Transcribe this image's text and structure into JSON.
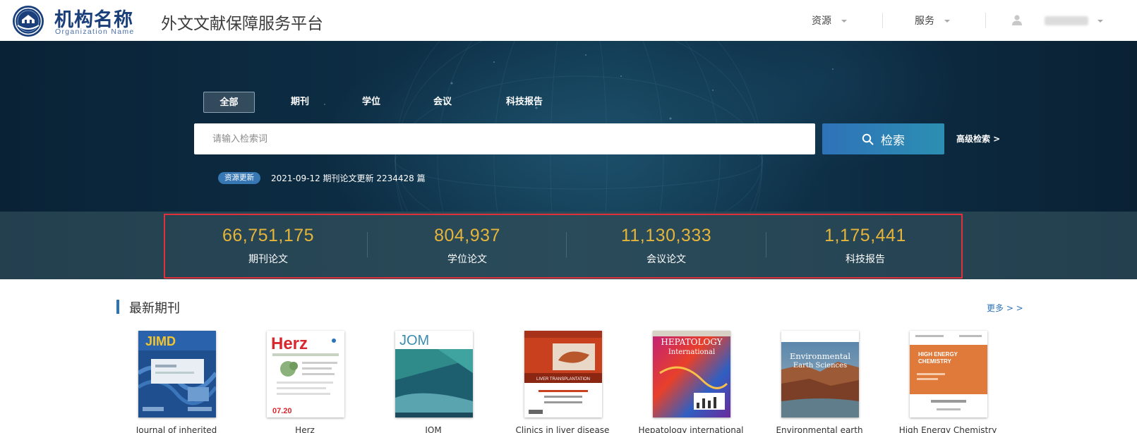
{
  "header": {
    "org_name": "机构名称",
    "org_name_en": "Organization Name",
    "platform_title": "外文文献保障服务平台",
    "nav": [
      {
        "label": "资源"
      },
      {
        "label": "服务"
      }
    ]
  },
  "search": {
    "tabs": [
      {
        "label": "全部",
        "active": true
      },
      {
        "label": "期刊",
        "active": false
      },
      {
        "label": "学位",
        "active": false
      },
      {
        "label": "会议",
        "active": false
      },
      {
        "label": "科技报告",
        "active": false
      }
    ],
    "placeholder": "请输入检索词",
    "button_label": "检索",
    "advanced_label": "高级检索 >",
    "update_badge": "资源更新",
    "update_text": "2021-09-12 期刊论文更新 2234428 篇"
  },
  "stats": [
    {
      "value": "66,751,175",
      "label": "期刊论文"
    },
    {
      "value": "804,937",
      "label": "学位论文"
    },
    {
      "value": "11,130,333",
      "label": "会议论文"
    },
    {
      "value": "1,175,441",
      "label": "科技报告"
    }
  ],
  "latest_journals": {
    "title": "最新期刊",
    "more_label": "更多 > >",
    "items": [
      {
        "title": "Journal of inherited",
        "cover_text": "JIMD"
      },
      {
        "title": "Herz",
        "cover_text": "Herz",
        "cover_subtext": "07.20"
      },
      {
        "title": "JOM",
        "cover_text": "JOM"
      },
      {
        "title": "Clinics in liver disease",
        "cover_text": "LIVER TRANSPLANTATION"
      },
      {
        "title": "Hepatology international",
        "cover_text": "HEPATOLOGY",
        "cover_subtext": "International"
      },
      {
        "title": "Environmental earth",
        "cover_text": "Environmental",
        "cover_subtext": "Earth Sciences"
      },
      {
        "title": "High Energy Chemistry",
        "cover_text": "HIGH ENERGY",
        "cover_subtext": "CHEMISTRY"
      }
    ]
  },
  "colors": {
    "accent_blue": "#2c73b8",
    "stat_gold": "#e5b53a",
    "highlight_red": "#e0313a",
    "logo_navy": "#1a3f7a"
  }
}
